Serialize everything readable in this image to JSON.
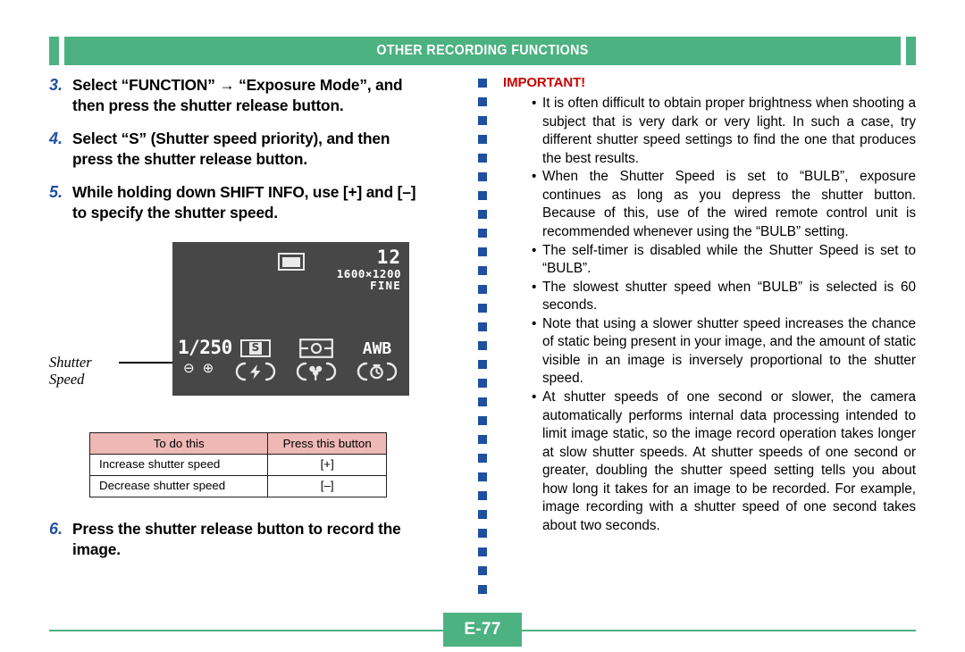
{
  "header": {
    "title": "OTHER RECORDING FUNCTIONS"
  },
  "steps": [
    {
      "num": "3.",
      "lines": [
        "Select “FUNCTION” → “Exposure Mode”, and",
        "then press the shutter release button."
      ]
    },
    {
      "num": "4.",
      "lines": [
        "Select “S” (Shutter speed priority), and then",
        "press the shutter release button."
      ]
    },
    {
      "num": "5.",
      "lines": [
        "While holding down SHIFT INFO, use [+] and [–]",
        "to specify the shutter speed."
      ]
    }
  ],
  "step6": {
    "num": "6.",
    "lines": [
      "Press the shutter release button to record the",
      "image."
    ]
  },
  "lcd": {
    "rec_icon": "record-frame-icon",
    "count": "12",
    "resolution": "1600×1200",
    "quality": "FINE",
    "shutter_speed": "1/250",
    "ev_minus": "⊖",
    "ev_plus": "⊕",
    "mode_letter": "S",
    "awb": "AWB",
    "flash_icon": "flash-auto-icon",
    "macro_icon": "macro-flower-icon",
    "selftimer_icon": "self-timer-icon",
    "metering_icon": "metering-icon",
    "callout": {
      "line1": "Shutter",
      "line2": "Speed"
    }
  },
  "table": {
    "headers": [
      "To do this",
      "Press this button"
    ],
    "rows": [
      [
        "Increase shutter speed",
        "[+]"
      ],
      [
        "Decrease shutter speed",
        "[–]"
      ]
    ]
  },
  "important": {
    "title": "IMPORTANT!",
    "bullet_char": "•",
    "items": [
      "It is often difficult to obtain proper brightness when shooting a subject that is very dark or very light. In such a case, try different shutter speed settings to find the one that produces the best results.",
      "When the Shutter Speed is set to “BULB”, exposure continues as long as you depress the shutter button. Because of this, use of the wired remote control unit is recommended whenever using the “BULB” setting.",
      "The self-timer is disabled while the Shutter Speed is set to “BULB”.",
      "The slowest shutter speed when “BULB” is selected is 60 seconds.",
      "Note that using a slower shutter speed increases the chance of static being present in your image, and the amount of static visible in an image is inversely proportional to the shutter speed.",
      "At shutter speeds of one second or slower, the camera automatically performs internal data processing intended to limit image static, so the image record operation takes longer at slow shutter speeds. At shutter speeds of one second or greater, doubling the shutter speed setting tells you about how long it takes for an image to be recorded. For example, image recording with a shutter speed of one second takes about two seconds."
    ]
  },
  "footer": {
    "page": "E-77"
  },
  "colors": {
    "green": "#4cb281",
    "blue": "#1f4fa0",
    "red": "#cc0000",
    "table_header": "#eeb8b5",
    "lcd_bg": "#474747"
  }
}
